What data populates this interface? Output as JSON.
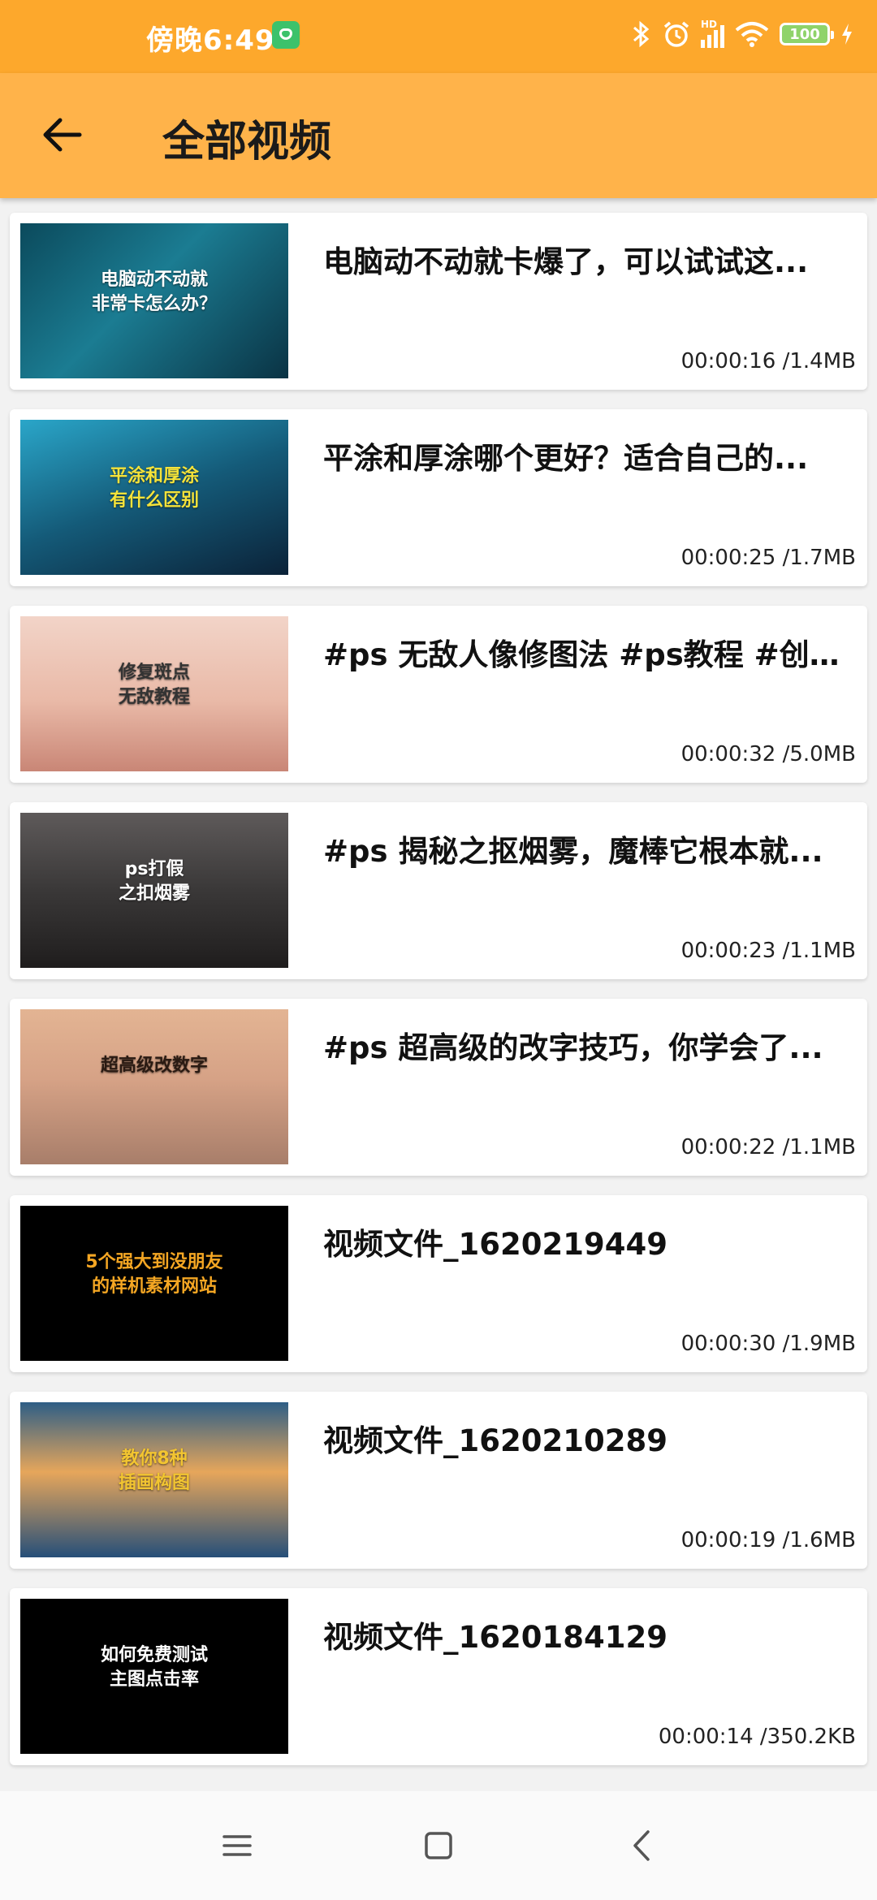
{
  "status_bar": {
    "time": "傍晚6:49",
    "network": "HD",
    "battery": "100"
  },
  "header": {
    "title": "全部视频"
  },
  "videos": [
    {
      "title": "电脑动不动就卡爆了，可以试试这...",
      "duration": "00:00:16",
      "size": "/1.4MB",
      "thumb_caption": "电脑动不动就\n非常卡怎么办？",
      "thumb_style": "tech-blue"
    },
    {
      "title": "平涂和厚涂哪个更好？适合自己的...",
      "duration": "00:00:25",
      "size": "/1.7MB",
      "thumb_caption": "平涂和厚涂\n有什么区别",
      "thumb_style": "anime-cyan"
    },
    {
      "title": "#ps 无敌人像修图法 #ps教程 #创...",
      "duration": "00:00:32",
      "size": "/5.0MB",
      "thumb_caption": "修复斑点\n无敌教程",
      "thumb_style": "portrait-pink"
    },
    {
      "title": "#ps 揭秘之抠烟雾，魔棒它根本就...",
      "duration": "00:00:23",
      "size": "/1.1MB",
      "thumb_caption": "ps打假\n之扣烟雾",
      "thumb_style": "smoke-gray"
    },
    {
      "title": "#ps 超高级的改字技巧，你学会了...",
      "duration": "00:00:22",
      "size": "/1.1MB",
      "thumb_caption": "超高级改数字",
      "thumb_style": "photo-tan"
    },
    {
      "title": "视频文件_1620219449",
      "duration": "00:00:30",
      "size": "/1.9MB",
      "thumb_caption": "5个强大到没朋友\n的样机素材网站",
      "thumb_style": "black-orange"
    },
    {
      "title": "视频文件_1620210289",
      "duration": "00:00:19",
      "size": "/1.6MB",
      "thumb_caption": "教你8种\n插画构图",
      "thumb_style": "sunset-blue"
    },
    {
      "title": "视频文件_1620184129",
      "duration": "00:00:14",
      "size": "/350.2KB",
      "thumb_caption": "如何免费测试\n主图点击率",
      "thumb_style": "black-white"
    }
  ],
  "thumb_styles": {
    "tech-blue": {
      "bg": "linear-gradient(135deg,#0b4a5c 0%,#1b7c92 45%,#0a3344 100%)",
      "text": "#ffffff"
    },
    "anime-cyan": {
      "bg": "linear-gradient(160deg,#2aa6c9 0%,#145a78 50%,#0b2238 100%)",
      "text": "#f5e33a"
    },
    "portrait-pink": {
      "bg": "linear-gradient(180deg,#f2d4c8 0%,#e9b9a7 55%,#c98676 100%)",
      "text": "#333333"
    },
    "smoke-gray": {
      "bg": "linear-gradient(180deg,#5e5a5a 0%,#3a3838 50%,#1f1d1d 100%)",
      "text": "#ffffff"
    },
    "photo-tan": {
      "bg": "linear-gradient(180deg,#e3b493 0%,#d6a286 45%,#a87e6a 100%)",
      "text": "#2a1a12"
    },
    "black-orange": {
      "bg": "#000000",
      "text": "#f4a623"
    },
    "sunset-blue": {
      "bg": "linear-gradient(180deg,#2e5e86 0%,#e6a65b 45%,#264f79 100%)",
      "text": "#f2c531"
    },
    "black-white": {
      "bg": "#000000",
      "text": "#ffffff"
    }
  },
  "colors": {
    "status_bar": "#fda82c",
    "app_bar": "#ffb34a",
    "background": "#f2f2f2"
  },
  "nav_icons": [
    "menu-icon",
    "home-icon",
    "back-nav-icon"
  ]
}
